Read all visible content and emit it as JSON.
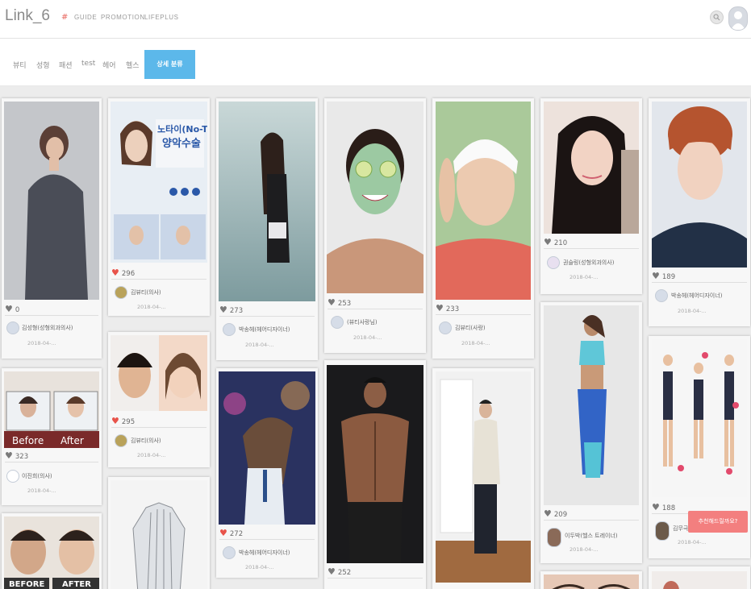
{
  "header": {
    "logo": "Link_6",
    "hash": "#",
    "nav": [
      "GUIDE",
      "PROMOTION",
      "LIFEPLUS"
    ]
  },
  "categories": [
    "뷰티",
    "성형",
    "패션",
    "test",
    "헤어",
    "헬스"
  ],
  "detail_button": "상세 분류",
  "cards": [
    {
      "likes": "0",
      "author": "김성형(성형외과의사)",
      "date": "2018-04-..."
    },
    {
      "likes": "296",
      "author": "김뷰티(의사)",
      "date": "2018-04-..."
    },
    {
      "likes": "273",
      "author": "박송헤(헤어디자이너)",
      "date": "2018-04-..."
    },
    {
      "likes": "253",
      "author": "(뷰티사랑님)",
      "date": "2018-04-..."
    },
    {
      "likes": "233",
      "author": "김뷰티(사랑)",
      "date": "2018-04-..."
    },
    {
      "likes": "210",
      "author": "권슬링(성형외과의사)",
      "date": "2018-04-..."
    },
    {
      "likes": "189",
      "author": "박송헤(헤어디자이너)",
      "date": "2018-04-..."
    },
    {
      "likes": "323",
      "author": "이진희(의사)",
      "date": "2018-04-..."
    },
    {
      "likes": "295",
      "author": "김뷰티(의사)",
      "date": "2018-04-..."
    },
    {
      "likes": "272",
      "author": "박송헤(헤어디자이너)",
      "date": "2018-04-..."
    },
    {
      "likes": "252",
      "author": "",
      "date": ""
    },
    {
      "likes": "209",
      "author": "이두박(헬스 트레이너)",
      "date": "2018-04-..."
    },
    {
      "likes": "188",
      "author": "김무극(...)",
      "date": "2018-04-..."
    }
  ],
  "image_text": {
    "notie_title": "노타이(No-Tie)",
    "notie_sub": "양악수술",
    "before": "Before",
    "after": "After",
    "before_caps": "BEFORE",
    "after_caps": "AFTER"
  },
  "chat_button": "추천해드릴까요?",
  "colors": {
    "accent": "#5cb8ea",
    "heart": "#e8534a",
    "chat": "#f37f7f"
  }
}
